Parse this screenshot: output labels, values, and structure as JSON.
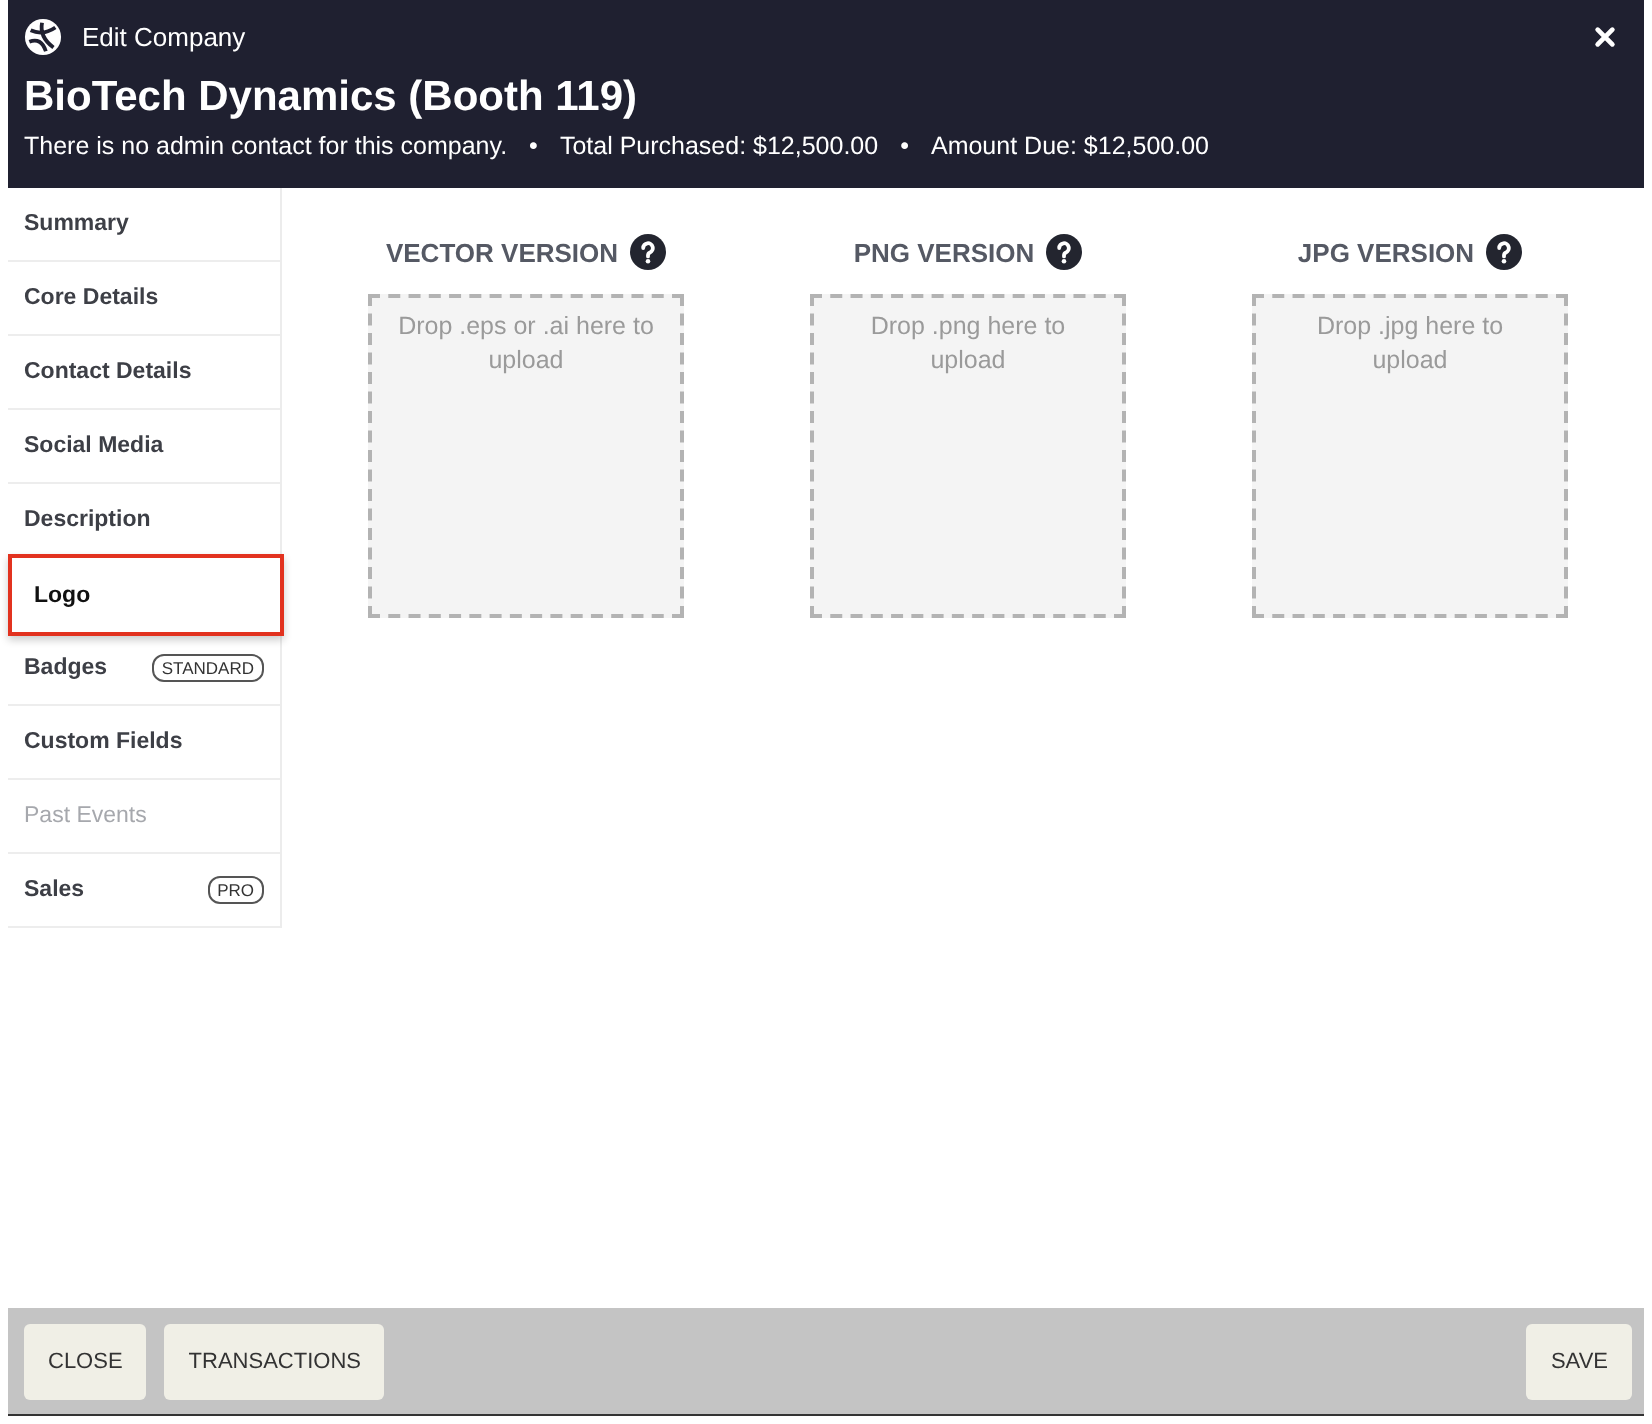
{
  "window": {
    "title": "Edit Company"
  },
  "header": {
    "company": "BioTech Dynamics (Booth 119)",
    "info": [
      {
        "kind": "text",
        "text": "There is no admin contact for this company."
      },
      {
        "kind": "separator",
        "text": "•"
      },
      {
        "kind": "text",
        "text": "Total Purchased: $12,500.00"
      },
      {
        "kind": "separator",
        "text": "•"
      },
      {
        "kind": "text",
        "text": "Amount Due: $12,500.00"
      }
    ]
  },
  "sidebar": {
    "items": [
      {
        "label": "Summary",
        "selected": false,
        "disabled": false
      },
      {
        "label": "Core Details",
        "selected": false,
        "disabled": false
      },
      {
        "label": "Contact Details",
        "selected": false,
        "disabled": false
      },
      {
        "label": "Social Media",
        "selected": false,
        "disabled": false
      },
      {
        "label": "Description",
        "selected": false,
        "disabled": false
      },
      {
        "label": "Logo",
        "selected": true,
        "disabled": false
      },
      {
        "label": "Badges",
        "badge": "STANDARD",
        "selected": false,
        "disabled": false
      },
      {
        "label": "Custom Fields",
        "selected": false,
        "disabled": false
      },
      {
        "label": "Past Events",
        "selected": false,
        "disabled": true
      },
      {
        "label": "Sales",
        "badge": "PRO",
        "selected": false,
        "disabled": false
      }
    ]
  },
  "uploads": [
    {
      "heading": "VECTOR VERSION",
      "placeholder": "Drop .eps or .ai here to upload"
    },
    {
      "heading": "PNG VERSION",
      "placeholder": "Drop .png here to upload"
    },
    {
      "heading": "JPG VERSION",
      "placeholder": "Drop .jpg here to upload"
    }
  ],
  "footer": {
    "left_buttons": [
      "CLOSE",
      "TRANSACTIONS"
    ],
    "right_buttons": [
      "SAVE"
    ]
  }
}
